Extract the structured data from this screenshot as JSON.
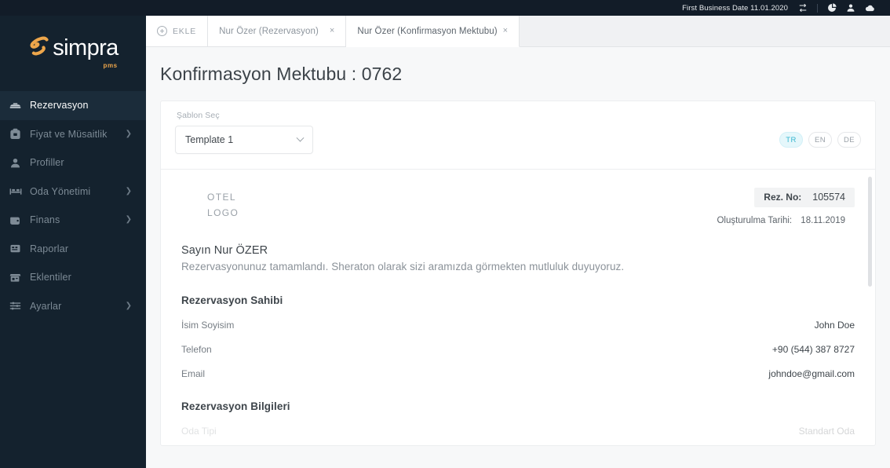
{
  "topbar": {
    "business_date": "First Business Date 11.01.2020",
    "icons": [
      {
        "name": "transfer-icon"
      },
      {
        "name": "pie-chart-icon"
      },
      {
        "name": "user-icon"
      },
      {
        "name": "cloud-icon"
      }
    ]
  },
  "sidebar": {
    "logo_text": "simpra",
    "logo_sub": "pms",
    "items": [
      {
        "label": "Rezervasyon",
        "icon": "bed-icon",
        "active": true,
        "chevron": false,
        "key": "rezervasyon"
      },
      {
        "label": "Fiyat ve Müsaitlik",
        "icon": "tag-icon",
        "active": false,
        "chevron": true,
        "key": "fiyat-ve-musaitlik"
      },
      {
        "label": "Profiller",
        "icon": "person-icon",
        "active": false,
        "chevron": false,
        "key": "profiller"
      },
      {
        "label": "Oda Yönetimi",
        "icon": "beds-icon",
        "active": false,
        "chevron": true,
        "key": "oda-yonetimi"
      },
      {
        "label": "Finans",
        "icon": "wallet-icon",
        "active": false,
        "chevron": true,
        "key": "finans"
      },
      {
        "label": "Raporlar",
        "icon": "report-icon",
        "active": false,
        "chevron": false,
        "key": "raporlar"
      },
      {
        "label": "Eklentiler",
        "icon": "plugin-icon",
        "active": false,
        "chevron": false,
        "key": "eklentiler"
      },
      {
        "label": "Ayarlar",
        "icon": "sliders-icon",
        "active": false,
        "chevron": true,
        "key": "ayarlar"
      }
    ]
  },
  "tabs": {
    "add_label": "EKLE",
    "items": [
      {
        "label": "Nur Özer (Rezervasyon)",
        "active": false,
        "close": "×"
      },
      {
        "label": "Nur Özer (Konfirmasyon Mektubu)",
        "active": true,
        "close": "×"
      }
    ]
  },
  "page": {
    "title": "Konfirmasyon Mektubu : 0762"
  },
  "toolbar": {
    "template_label": "Şablon Seç",
    "template_value": "Template 1",
    "languages": [
      {
        "code": "TR",
        "active": true
      },
      {
        "code": "EN",
        "active": false
      },
      {
        "code": "DE",
        "active": false
      }
    ]
  },
  "document": {
    "logo_line1": "OTEL",
    "logo_line2": "LOGO",
    "rez_no_label": "Rez. No:",
    "rez_no_value": "105574",
    "created_label": "Oluşturulma Tarihi:",
    "created_value": "18.11.2019",
    "salutation": "Sayın Nur ÖZER",
    "intro": "Rezervasyonunuz tamamlandı. Sheraton olarak sizi aramızda görmekten mutluluk duyuyoruz.",
    "owner_section_title": "Rezervasyon Sahibi",
    "owner_rows": [
      {
        "key": "İsim Soyisim",
        "value": "John Doe"
      },
      {
        "key": "Telefon",
        "value": "+90 (544) 387 8727"
      },
      {
        "key": "Email",
        "value": "johndoe@gmail.com"
      }
    ],
    "info_section_title": "Rezervasyon Bilgileri",
    "clipped_row": {
      "key": "Oda Tipi",
      "value": "Standart Oda"
    }
  },
  "colors": {
    "sidebar_bg": "#14222e",
    "topbar_bg": "#121c28",
    "accent_orange": "#eda64b",
    "accent_teal": "#38b6cf",
    "page_bg": "#f7f8f9"
  }
}
